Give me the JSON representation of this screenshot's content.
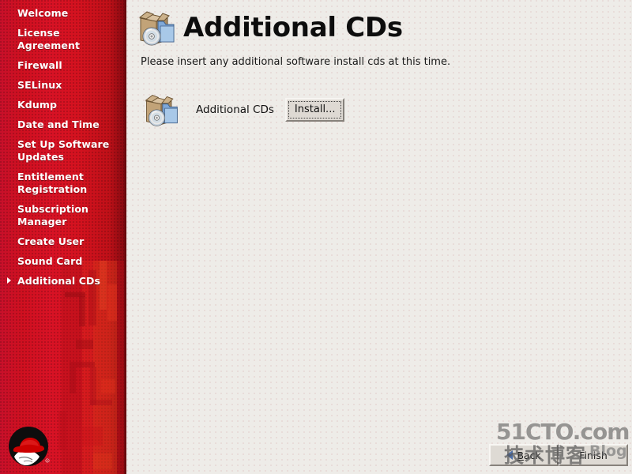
{
  "window": {
    "title": "Additional CDs"
  },
  "sidebar": {
    "items": [
      {
        "label": "Welcome",
        "active": false
      },
      {
        "label": "License Agreement",
        "active": false
      },
      {
        "label": "Firewall",
        "active": false
      },
      {
        "label": "SELinux",
        "active": false
      },
      {
        "label": "Kdump",
        "active": false
      },
      {
        "label": "Date and Time",
        "active": false
      },
      {
        "label": "Set Up Software Updates",
        "active": false
      },
      {
        "label": "Entitlement Registration",
        "active": false
      },
      {
        "label": "Subscription Manager",
        "active": false
      },
      {
        "label": "Create User",
        "active": false
      },
      {
        "label": "Sound Card",
        "active": false
      },
      {
        "label": "Additional CDs",
        "active": true
      }
    ],
    "logo_name": "red-hat-shadowman-logo",
    "background_color": "#d4121f",
    "text_color": "#ffffff"
  },
  "main": {
    "header_icon": "additional-cds-box-icon",
    "title": "Additional CDs",
    "description": "Please insert any additional software install cds at this time.",
    "cd_row": {
      "icon": "additional-cds-box-icon",
      "label": "Additional CDs",
      "install_button": "Install..."
    }
  },
  "footer": {
    "back_button": {
      "label": "Back",
      "mnemonic": "B",
      "rest": "ack",
      "icon": "arrow-left-icon"
    },
    "finish_button": {
      "label": "Finish"
    }
  },
  "watermark": {
    "site": "51CTO.com",
    "chinese": "技术博客",
    "blog": "Blog"
  },
  "colors": {
    "accent_red": "#d4121f",
    "sidebar_edge": "#6d070c",
    "content_bg": "#eeece8",
    "title_text": "#0d0d0d",
    "arrow_blue": "#4d6fa8"
  }
}
